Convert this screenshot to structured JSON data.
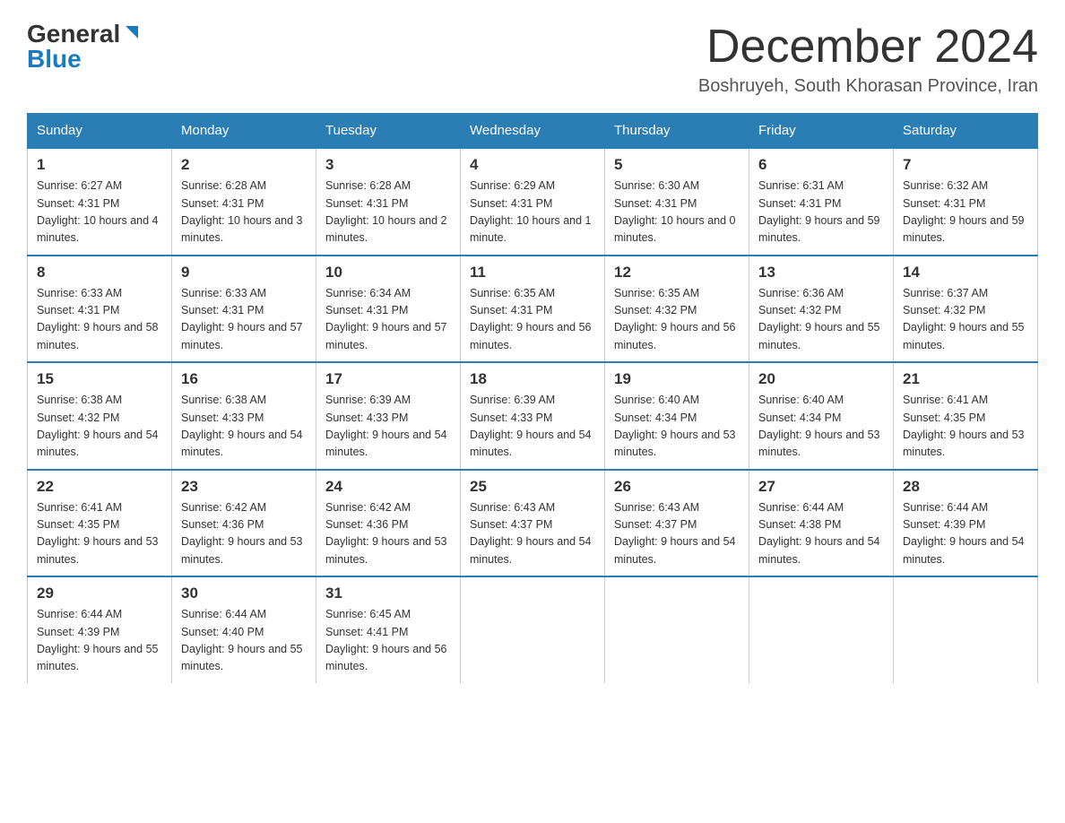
{
  "logo": {
    "general": "General",
    "blue": "Blue"
  },
  "title": "December 2024",
  "subtitle": "Boshruyeh, South Khorasan Province, Iran",
  "days_of_week": [
    "Sunday",
    "Monday",
    "Tuesday",
    "Wednesday",
    "Thursday",
    "Friday",
    "Saturday"
  ],
  "weeks": [
    [
      {
        "day": "1",
        "sunrise": "6:27 AM",
        "sunset": "4:31 PM",
        "daylight": "10 hours and 4 minutes."
      },
      {
        "day": "2",
        "sunrise": "6:28 AM",
        "sunset": "4:31 PM",
        "daylight": "10 hours and 3 minutes."
      },
      {
        "day": "3",
        "sunrise": "6:28 AM",
        "sunset": "4:31 PM",
        "daylight": "10 hours and 2 minutes."
      },
      {
        "day": "4",
        "sunrise": "6:29 AM",
        "sunset": "4:31 PM",
        "daylight": "10 hours and 1 minute."
      },
      {
        "day": "5",
        "sunrise": "6:30 AM",
        "sunset": "4:31 PM",
        "daylight": "10 hours and 0 minutes."
      },
      {
        "day": "6",
        "sunrise": "6:31 AM",
        "sunset": "4:31 PM",
        "daylight": "9 hours and 59 minutes."
      },
      {
        "day": "7",
        "sunrise": "6:32 AM",
        "sunset": "4:31 PM",
        "daylight": "9 hours and 59 minutes."
      }
    ],
    [
      {
        "day": "8",
        "sunrise": "6:33 AM",
        "sunset": "4:31 PM",
        "daylight": "9 hours and 58 minutes."
      },
      {
        "day": "9",
        "sunrise": "6:33 AM",
        "sunset": "4:31 PM",
        "daylight": "9 hours and 57 minutes."
      },
      {
        "day": "10",
        "sunrise": "6:34 AM",
        "sunset": "4:31 PM",
        "daylight": "9 hours and 57 minutes."
      },
      {
        "day": "11",
        "sunrise": "6:35 AM",
        "sunset": "4:31 PM",
        "daylight": "9 hours and 56 minutes."
      },
      {
        "day": "12",
        "sunrise": "6:35 AM",
        "sunset": "4:32 PM",
        "daylight": "9 hours and 56 minutes."
      },
      {
        "day": "13",
        "sunrise": "6:36 AM",
        "sunset": "4:32 PM",
        "daylight": "9 hours and 55 minutes."
      },
      {
        "day": "14",
        "sunrise": "6:37 AM",
        "sunset": "4:32 PM",
        "daylight": "9 hours and 55 minutes."
      }
    ],
    [
      {
        "day": "15",
        "sunrise": "6:38 AM",
        "sunset": "4:32 PM",
        "daylight": "9 hours and 54 minutes."
      },
      {
        "day": "16",
        "sunrise": "6:38 AM",
        "sunset": "4:33 PM",
        "daylight": "9 hours and 54 minutes."
      },
      {
        "day": "17",
        "sunrise": "6:39 AM",
        "sunset": "4:33 PM",
        "daylight": "9 hours and 54 minutes."
      },
      {
        "day": "18",
        "sunrise": "6:39 AM",
        "sunset": "4:33 PM",
        "daylight": "9 hours and 54 minutes."
      },
      {
        "day": "19",
        "sunrise": "6:40 AM",
        "sunset": "4:34 PM",
        "daylight": "9 hours and 53 minutes."
      },
      {
        "day": "20",
        "sunrise": "6:40 AM",
        "sunset": "4:34 PM",
        "daylight": "9 hours and 53 minutes."
      },
      {
        "day": "21",
        "sunrise": "6:41 AM",
        "sunset": "4:35 PM",
        "daylight": "9 hours and 53 minutes."
      }
    ],
    [
      {
        "day": "22",
        "sunrise": "6:41 AM",
        "sunset": "4:35 PM",
        "daylight": "9 hours and 53 minutes."
      },
      {
        "day": "23",
        "sunrise": "6:42 AM",
        "sunset": "4:36 PM",
        "daylight": "9 hours and 53 minutes."
      },
      {
        "day": "24",
        "sunrise": "6:42 AM",
        "sunset": "4:36 PM",
        "daylight": "9 hours and 53 minutes."
      },
      {
        "day": "25",
        "sunrise": "6:43 AM",
        "sunset": "4:37 PM",
        "daylight": "9 hours and 54 minutes."
      },
      {
        "day": "26",
        "sunrise": "6:43 AM",
        "sunset": "4:37 PM",
        "daylight": "9 hours and 54 minutes."
      },
      {
        "day": "27",
        "sunrise": "6:44 AM",
        "sunset": "4:38 PM",
        "daylight": "9 hours and 54 minutes."
      },
      {
        "day": "28",
        "sunrise": "6:44 AM",
        "sunset": "4:39 PM",
        "daylight": "9 hours and 54 minutes."
      }
    ],
    [
      {
        "day": "29",
        "sunrise": "6:44 AM",
        "sunset": "4:39 PM",
        "daylight": "9 hours and 55 minutes."
      },
      {
        "day": "30",
        "sunrise": "6:44 AM",
        "sunset": "4:40 PM",
        "daylight": "9 hours and 55 minutes."
      },
      {
        "day": "31",
        "sunrise": "6:45 AM",
        "sunset": "4:41 PM",
        "daylight": "9 hours and 56 minutes."
      },
      null,
      null,
      null,
      null
    ]
  ]
}
